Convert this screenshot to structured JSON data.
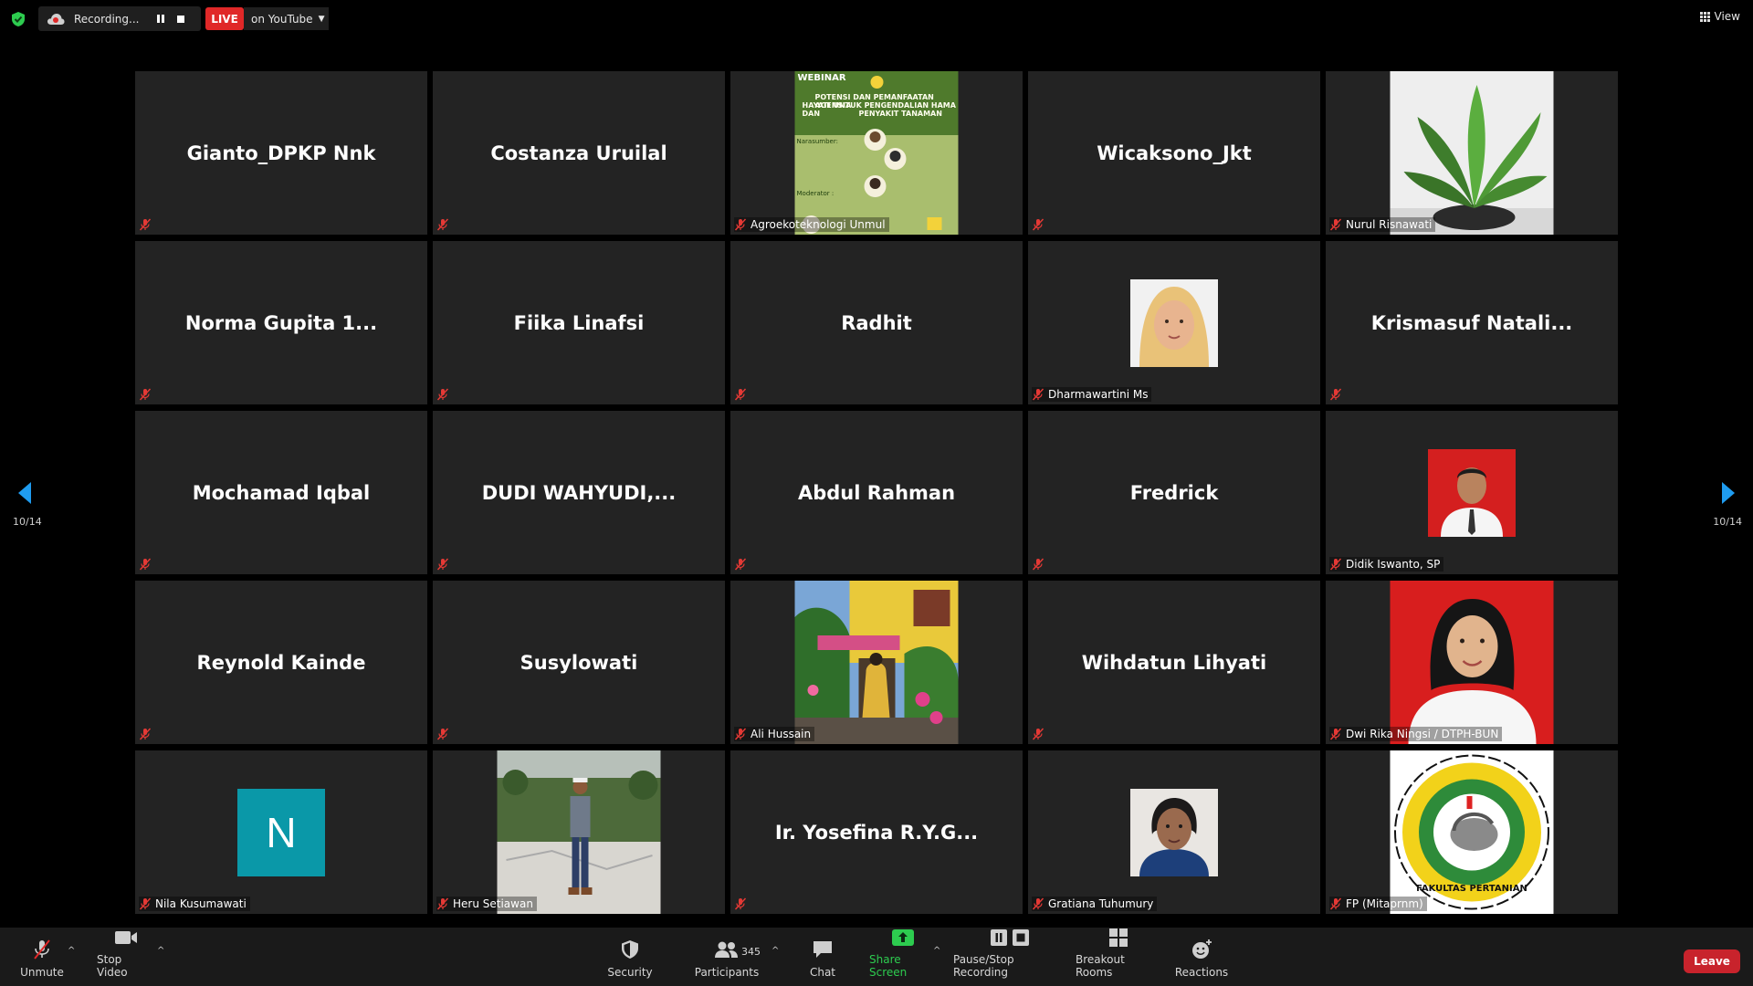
{
  "topbar": {
    "recording_label": "Recording...",
    "live_label": "LIVE",
    "live_destination": "on YouTube",
    "view_label": "View"
  },
  "pagination": {
    "left": "10/14",
    "right": "10/14"
  },
  "participants": [
    {
      "name": "Gianto_DPKP Nnk",
      "label": "",
      "media": ""
    },
    {
      "name": "Costanza Uruilal",
      "label": "",
      "media": ""
    },
    {
      "name": "",
      "label": "Agroekoteknologi Unmul",
      "media": "poster",
      "poster": {
        "l1": "WEBINAR",
        "l2": "POTENSI DAN PEMANFAATAN AGENSIA",
        "l3": "HAYATI UNTUK PENGENDALIAN HAMA DAN",
        "l4": "PENYAKIT TANAMAN",
        "l5": "Narasumber:",
        "l6": "Moderator :"
      }
    },
    {
      "name": "Wicaksono_Jkt",
      "label": "",
      "media": ""
    },
    {
      "name": "",
      "label": "Nurul Risnawati",
      "media": "plant"
    },
    {
      "name": "Norma Gupita 1...",
      "label": "",
      "media": ""
    },
    {
      "name": "Fiika Linafsi",
      "label": "",
      "media": ""
    },
    {
      "name": "Radhit",
      "label": "",
      "media": ""
    },
    {
      "name": "",
      "label": "Dharmawartini Ms",
      "media": "hijab-face"
    },
    {
      "name": "Krismasuf  Natali...",
      "label": "",
      "media": ""
    },
    {
      "name": "Mochamad Iqbal",
      "label": "",
      "media": ""
    },
    {
      "name": "DUDI  WAHYUDI,...",
      "label": "",
      "media": ""
    },
    {
      "name": "Abdul Rahman",
      "label": "",
      "media": ""
    },
    {
      "name": "Fredrick",
      "label": "",
      "media": ""
    },
    {
      "name": "",
      "label": "Didik Iswanto, SP",
      "media": "red-portrait"
    },
    {
      "name": "Reynold Kainde",
      "label": "",
      "media": ""
    },
    {
      "name": "Susylowati",
      "label": "",
      "media": ""
    },
    {
      "name": "",
      "label": "Ali Hussain",
      "media": "garden"
    },
    {
      "name": "Wihdatun Lihyati",
      "label": "",
      "media": ""
    },
    {
      "name": "",
      "label": "Dwi Rika Ningsi / DTPH-BUN",
      "media": "red-hijab"
    },
    {
      "name": "",
      "label": "Nila Kusumawati",
      "media": "avatar-n",
      "avatar_letter": "N"
    },
    {
      "name": "",
      "label": "Heru Setiawan",
      "media": "field"
    },
    {
      "name": "Ir. Yosefina R.Y.G...",
      "label": "",
      "media": ""
    },
    {
      "name": "",
      "label": "Gratiana Tuhumury",
      "media": "woman-face"
    },
    {
      "name": "",
      "label": "FP (Mitaprnm)",
      "media": "logo",
      "logo_text": "FAKULTAS PERTANIAN"
    }
  ],
  "toolbar": {
    "unmute": "Unmute",
    "stop_video": "Stop Video",
    "security": "Security",
    "participants": "Participants",
    "participant_count": "345",
    "chat": "Chat",
    "share_screen": "Share Screen",
    "pause_stop_recording": "Pause/Stop Recording",
    "breakout_rooms": "Breakout Rooms",
    "reactions": "Reactions",
    "leave": "Leave"
  },
  "colors": {
    "tile_bg": "#232323",
    "live_red": "#e02828",
    "share_green": "#2dcc4f",
    "nav_blue": "#1f9cf0",
    "avatar_teal": "#0a98a8",
    "leave_red": "#c8232c"
  }
}
